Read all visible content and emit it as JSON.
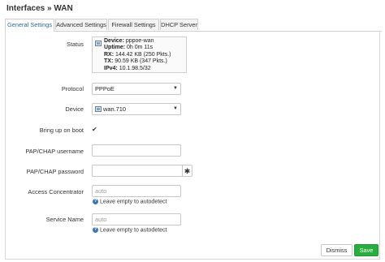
{
  "page": {
    "title": "Interfaces » WAN"
  },
  "tabs": [
    {
      "label": "General Settings",
      "active": true
    },
    {
      "label": "Advanced Settings",
      "active": false
    },
    {
      "label": "Firewall Settings",
      "active": false
    },
    {
      "label": "DHCP Server",
      "active": false
    }
  ],
  "form": {
    "status": {
      "label": "Status",
      "icon": "network-interface-icon",
      "lines": [
        {
          "key": "Device:",
          "value": "pppoe-wan"
        },
        {
          "key": "Uptime:",
          "value": "0h 0m 11s"
        },
        {
          "key": "RX:",
          "value": "144.42 KB (250 Pkts.)"
        },
        {
          "key": "TX:",
          "value": "90.59 KB (347 Pkts.)"
        },
        {
          "key": "IPv4:",
          "value": "10.1.98.5/32"
        }
      ]
    },
    "protocol": {
      "label": "Protocol",
      "value": "PPPoE"
    },
    "device": {
      "label": "Device",
      "value": "wan.710"
    },
    "bring_up_on_boot": {
      "label": "Bring up on boot",
      "checked": true,
      "glyph": "✔"
    },
    "pap_chap_username": {
      "label": "PAP/CHAP username",
      "value": ""
    },
    "pap_chap_password": {
      "label": "PAP/CHAP password",
      "value": "",
      "reveal_glyph": "✱"
    },
    "access_concentrator": {
      "label": "Access Concentrator",
      "placeholder": "auto",
      "hint": "Leave empty to autodetect"
    },
    "service_name": {
      "label": "Service Name",
      "placeholder": "auto",
      "hint": "Leave empty to autodetect"
    }
  },
  "footer": {
    "dismiss_label": "Dismiss",
    "save_label": "Save"
  },
  "colors": {
    "accent": "#2d6aa4",
    "save": "#27ae3d",
    "help": "#3a77b7"
  }
}
